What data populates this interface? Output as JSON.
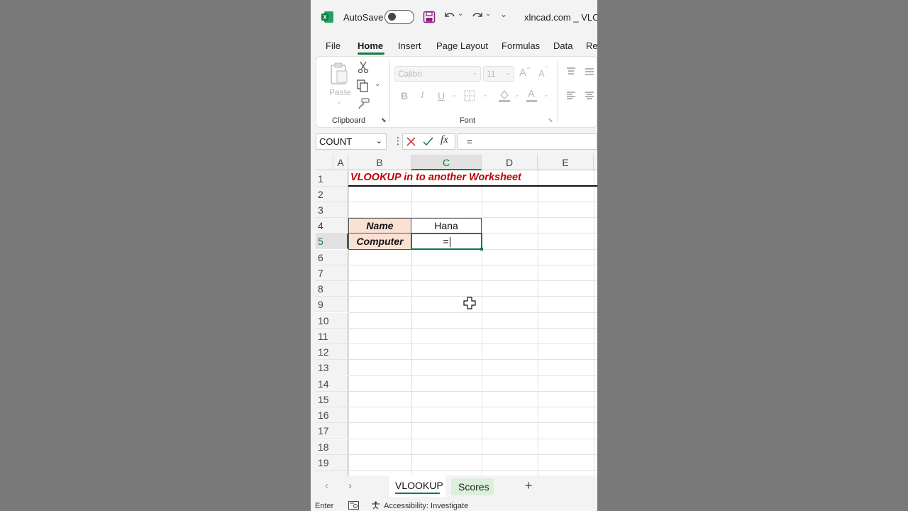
{
  "titlebar": {
    "autosave_label": "AutoSave",
    "autosave_state": "Off",
    "filename": "xlncad.com _ VLOO"
  },
  "tabs": [
    {
      "label": "File",
      "active": false
    },
    {
      "label": "Home",
      "active": true
    },
    {
      "label": "Insert",
      "active": false
    },
    {
      "label": "Page Layout",
      "active": false
    },
    {
      "label": "Formulas",
      "active": false
    },
    {
      "label": "Data",
      "active": false
    },
    {
      "label": "Re",
      "active": false
    }
  ],
  "ribbon": {
    "clipboard": {
      "label": "Clipboard",
      "paste_label": "Paste"
    },
    "font": {
      "label": "Font",
      "font_name": "Calibri",
      "font_size": "11",
      "bold": "B",
      "italic": "I",
      "underline": "U",
      "grow": "A",
      "shrink": "A",
      "font_color": "A"
    }
  },
  "formula_bar": {
    "name_box": "COUNT",
    "fx_label": "fx",
    "formula": "="
  },
  "grid": {
    "columns": [
      "A",
      "B",
      "C",
      "D",
      "E"
    ],
    "selected_column": "C",
    "rows": [
      "1",
      "2",
      "3",
      "4",
      "5",
      "6",
      "7",
      "8",
      "9",
      "10",
      "11",
      "12",
      "13",
      "14",
      "15",
      "16",
      "17",
      "18",
      "19"
    ],
    "selected_row": "5",
    "title": "VLOOKUP in to another Worksheet",
    "label_name": "Name",
    "label_computer": "Computer",
    "value_name": "Hana",
    "active_cell_value": "=",
    "title_color": "#c00000",
    "label_fill": "#fbe1d4"
  },
  "sheets": [
    {
      "label": "VLOOKUP",
      "active": true
    },
    {
      "label": "Scores",
      "active": false
    }
  ],
  "sheet_controls": {
    "add": "+"
  },
  "status": {
    "mode": "Enter",
    "accessibility": "Accessibility: Investigate"
  },
  "colors": {
    "accent": "#107c41"
  }
}
